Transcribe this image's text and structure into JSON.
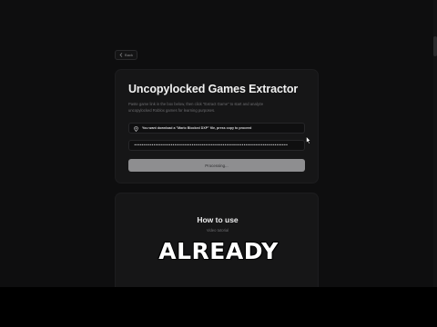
{
  "nav": {
    "back_label": "Back"
  },
  "extractor": {
    "title": "Uncopylocked Games Extractor",
    "description": "Paste game link in the box below, then click \"Extract Game\" to start and analyze uncopylocked Roblox games for learning purposes.",
    "notice": "You want download a \"Mario Blocked DXP\" file, press copy to proceed",
    "password_value": "••••••••••••••••••••••••••••••••••••••••••••••••••••••••••••••••••••••••••••••••",
    "button_label": "Processing..."
  },
  "howto": {
    "title": "How to use",
    "subtitle": "Video tutorial"
  },
  "overlay": {
    "caption": "ALREADY"
  },
  "icons": {
    "back": "chevron-left-icon",
    "notice": "pin-icon",
    "cursor": "mouse-cursor-icon"
  },
  "colors": {
    "page_bg": "#0e0e0f",
    "card_bg": "#161617",
    "button_bg": "#8e8e90"
  }
}
